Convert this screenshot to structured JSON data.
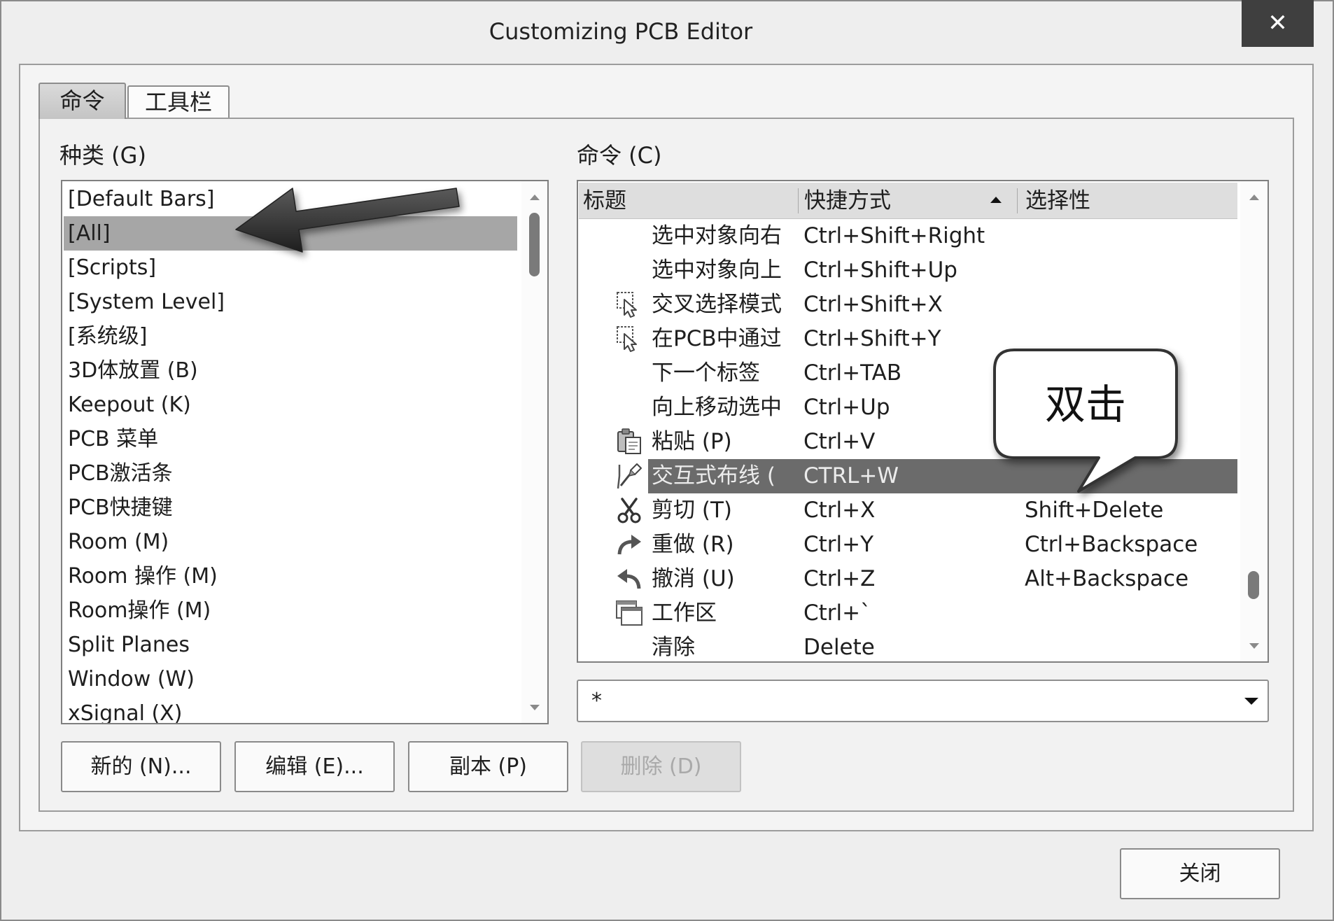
{
  "window": {
    "title": "Customizing PCB Editor",
    "close_glyph": "✕"
  },
  "tabs": [
    {
      "label": "命令",
      "selected": true
    },
    {
      "label": "工具栏",
      "selected": false
    }
  ],
  "categories": {
    "label": "种类 (G)",
    "selected_index": 1,
    "items": [
      "[Default Bars]",
      "[All]",
      "[Scripts]",
      "[System Level]",
      "[系统级]",
      "3D体放置 (B)",
      "Keepout (K)",
      "PCB 菜单",
      "PCB激活条",
      "PCB快捷键",
      "Room (M)",
      "Room 操作 (M)",
      "Room操作 (M)",
      "Split Planes",
      "Window (W)",
      "xSignal (X)"
    ]
  },
  "commands": {
    "label": "命令 (C)",
    "columns": {
      "title": "标题",
      "shortcut": "快捷方式",
      "selectivity": "选择性"
    },
    "sort_icon": "sort-ascending-icon",
    "rows": [
      {
        "title": "选中对象向右",
        "shortcut": "Ctrl+Shift+Right"
      },
      {
        "title": "选中对象向上",
        "shortcut": "Ctrl+Shift+Up"
      },
      {
        "icon": "cross-select-icon",
        "title": "交叉选择模式",
        "shortcut": "Ctrl+Shift+X"
      },
      {
        "icon": "cross-select-icon",
        "title": "在PCB中通过",
        "shortcut": "Ctrl+Shift+Y"
      },
      {
        "title": "下一个标签",
        "shortcut": "Ctrl+TAB"
      },
      {
        "title": "向上移动选中",
        "shortcut": "Ctrl+Up"
      },
      {
        "icon": "paste-icon",
        "title": "粘贴 (P)",
        "shortcut": "Ctrl+V"
      },
      {
        "icon": "interactive-route-icon",
        "title": "交互式布线 (",
        "shortcut": "CTRL+W",
        "selected": true
      },
      {
        "icon": "scissors-icon",
        "title": "剪切 (T)",
        "shortcut": "Ctrl+X",
        "selectivity": "Shift+Delete"
      },
      {
        "icon": "redo-icon",
        "title": "重做 (R)",
        "shortcut": "Ctrl+Y",
        "selectivity": "Ctrl+Backspace"
      },
      {
        "icon": "undo-icon",
        "title": "撤消 (U)",
        "shortcut": "Ctrl+Z",
        "selectivity": "Alt+Backspace"
      },
      {
        "icon": "workspace-icon",
        "title": "工作区",
        "shortcut": "Ctrl+`"
      },
      {
        "title": "清除",
        "shortcut": "Delete"
      }
    ],
    "filter": {
      "value": "*"
    }
  },
  "buttons": {
    "new": "新的 (N)...",
    "edit": "编辑 (E)...",
    "copy": "副本 (P)",
    "delete": "删除 (D)",
    "delete_enabled": false,
    "close": "关闭"
  },
  "annotation": {
    "callout_text": "双击",
    "arrow_target": "[All]"
  },
  "colors": {
    "window_bg": "#eeeeee",
    "selection_bg": "#a6a6a6",
    "active_row_bg": "#6b6b6b",
    "close_button_bg": "#3f3f3f"
  }
}
